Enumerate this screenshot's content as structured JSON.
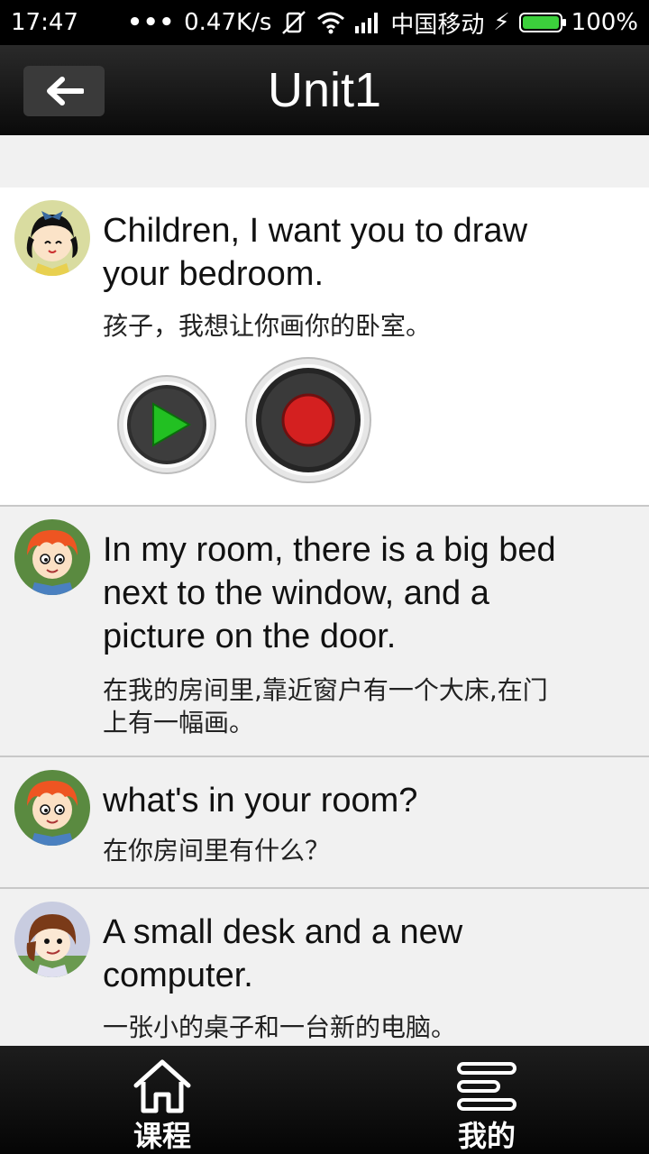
{
  "status_bar": {
    "time": "17:47",
    "network_speed": "0.47K/s",
    "carrier": "中国移动",
    "battery": "100%",
    "battery_level": 1.0,
    "battery_color": "#3cd03c"
  },
  "header": {
    "title": "Unit1"
  },
  "dialogue": [
    {
      "en": "Children, I want you to draw your bedroom.",
      "cn": "孩子，我想让你画你的卧室。",
      "speaker": "girl-with-bow"
    },
    {
      "en": "In my room, there is a big bed next to the window, and a picture on the door.",
      "cn": "在我的房间里,靠近窗户有一个大床,在门上有一幅画。",
      "speaker": "red-haired-boy"
    },
    {
      "en": "what's in your room?",
      "cn": "在你房间里有什么？",
      "speaker": "red-haired-boy"
    },
    {
      "en": "A small desk and a new computer.",
      "cn": "一张小的桌子和一台新的电脑。",
      "speaker": "brown-haired-girl"
    }
  ],
  "controls": {
    "play_icon": "play-icon",
    "record_icon": "record-icon",
    "play_color": "#22c022",
    "record_color": "#d42020"
  },
  "bottom_nav": {
    "courses_label": "课程",
    "mine_label": "我的"
  }
}
